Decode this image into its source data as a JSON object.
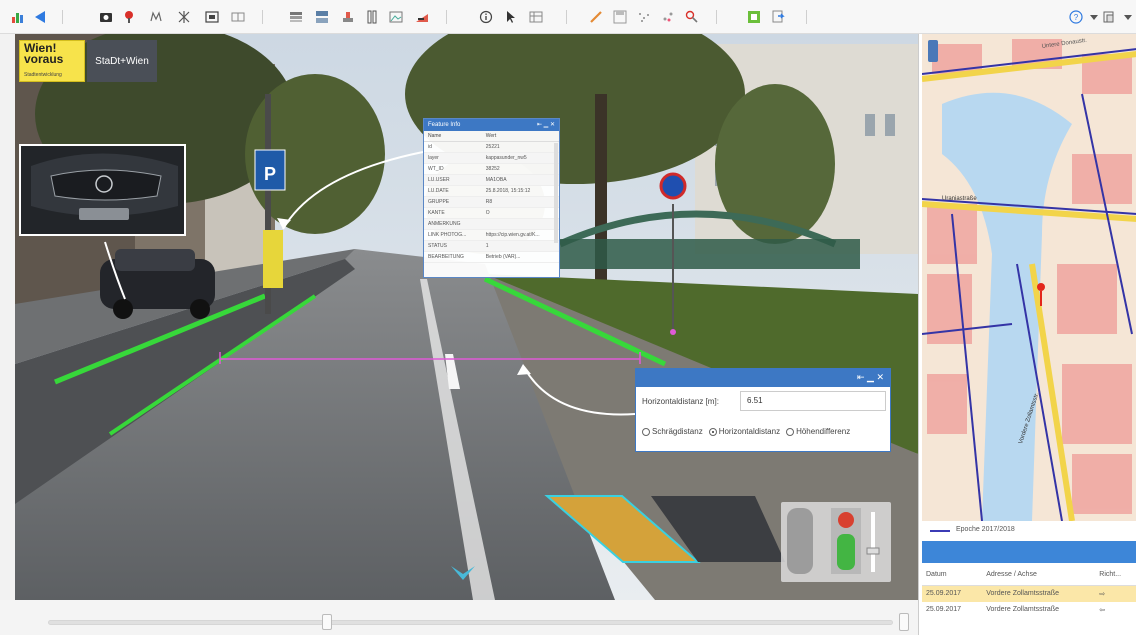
{
  "toolbar": {
    "icons": [
      "chart-icon",
      "back-arrow-icon",
      "camera-icon",
      "pin-icon",
      "tree-icon",
      "grid-icon",
      "frame-icon",
      "book-icon",
      "layers-icon",
      "split-view-icon",
      "depth-icon",
      "column-icon",
      "photo-icon",
      "road-icon",
      "info-icon",
      "cursor-icon",
      "table-icon",
      "pencil-icon",
      "save-icon",
      "dots-icon",
      "scatter-icon",
      "search-icon",
      "export-icon",
      "refresh-icon",
      "help-icon",
      "window-icon"
    ]
  },
  "viewer": {
    "logo_primary": "Wien!\nvoraus",
    "logo_primary_sub": "Stadtentwicklung",
    "logo_secondary": "StaDt+Wien",
    "colors": {
      "green_line": "#37d83a",
      "magenta_line": "#e05ad8",
      "accent": "#3d78c4"
    }
  },
  "feature_info": {
    "title": "Feature Info",
    "columns": [
      "Name",
      "Wert"
    ],
    "rows": [
      [
        "id",
        "25221"
      ],
      [
        "layer",
        "kappasunder_nw5"
      ],
      [
        "WT_ID",
        "38252"
      ],
      [
        "LU.USER",
        "MA1OBA"
      ],
      [
        "LU.DATE",
        "25.8.2018, 15:15:12"
      ],
      [
        "GRUPPE",
        "R8"
      ],
      [
        "KANTE",
        "O"
      ],
      [
        "ANMERKUNG",
        ""
      ],
      [
        "LINK PHOTOG...",
        "https://cip.wien.gv.at/K..."
      ],
      [
        "STATUS",
        "1"
      ],
      [
        "BEARBEITUNG",
        "Betrieb (VAR)..."
      ]
    ]
  },
  "measure": {
    "label": "Horizontaldistanz [m]:",
    "value": "6.51",
    "options": [
      "Schrägdistanz",
      "Horizontaldistanz",
      "Höhendifferenz"
    ],
    "selected": "Horizontaldistanz"
  },
  "timeline": {
    "position": 0.33
  },
  "map": {
    "streets": [
      "Untere Donaustr.",
      "Uraniastraße",
      "Vordere Zollamtsstr."
    ],
    "legend": "Epoche 2017/2018"
  },
  "history": {
    "columns": [
      "Datum",
      "Adresse / Achse",
      "Richt..."
    ],
    "rows": [
      {
        "date": "25.09.2017",
        "address": "Vordere Zollamtsstraße",
        "dir": "⇨",
        "selected": true
      },
      {
        "date": "25.09.2017",
        "address": "Vordere Zollamtsstraße",
        "dir": "⇦",
        "selected": false
      }
    ]
  }
}
